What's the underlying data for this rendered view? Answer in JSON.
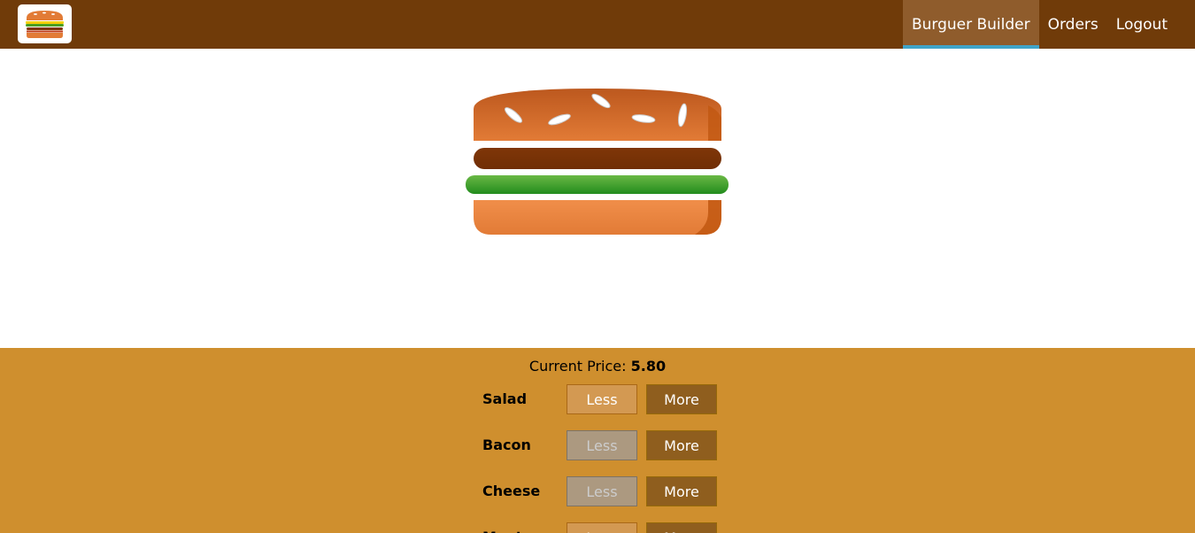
{
  "nav": {
    "logo_alt": "Burger logo",
    "items": [
      {
        "label": "Burguer Builder",
        "active": true
      },
      {
        "label": "Orders",
        "active": false
      },
      {
        "label": "Logout",
        "active": false
      }
    ]
  },
  "price": {
    "label": "Current Price:",
    "value": "5.80"
  },
  "controls": [
    {
      "label": "Salad",
      "less": "Less",
      "more": "More",
      "less_disabled": false
    },
    {
      "label": "Bacon",
      "less": "Less",
      "more": "More",
      "less_disabled": true
    },
    {
      "label": "Cheese",
      "less": "Less",
      "more": "More",
      "less_disabled": true
    },
    {
      "label": "Meat",
      "less": "Less",
      "more": "More",
      "less_disabled": false
    }
  ],
  "colors": {
    "toolbar": "#703b09",
    "active_nav": "#8f5c2c",
    "active_underline": "#40a4c8",
    "controls_bg": "#cf8f2e",
    "less_btn": "#d39952",
    "less_btn_disabled": "#ac9980",
    "more_btn": "#8f5e1e",
    "bread": "#e27b36",
    "meat": "#7f3608",
    "salad": "#4c9f22"
  },
  "icons": {
    "logo": "burger-logo-icon"
  }
}
